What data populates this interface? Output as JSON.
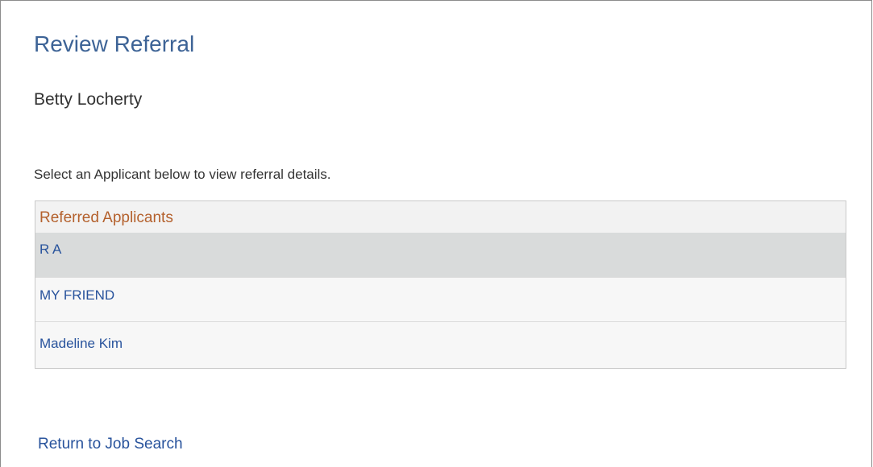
{
  "page": {
    "title": "Review Referral",
    "person_name": "Betty Locherty",
    "instruction": "Select an Applicant below to view referral details."
  },
  "grid": {
    "header": "Referred Applicants",
    "rows": [
      {
        "name": "R A",
        "selected": true
      },
      {
        "name": "MY FRIEND",
        "selected": false
      },
      {
        "name": "Madeline Kim",
        "selected": false
      }
    ]
  },
  "links": {
    "return_to_job_search": "Return to Job Search"
  },
  "colors": {
    "title": "#3d6396",
    "link": "#28539c",
    "grid_header": "#b4612d",
    "selected_row": "#d9dbdb"
  }
}
